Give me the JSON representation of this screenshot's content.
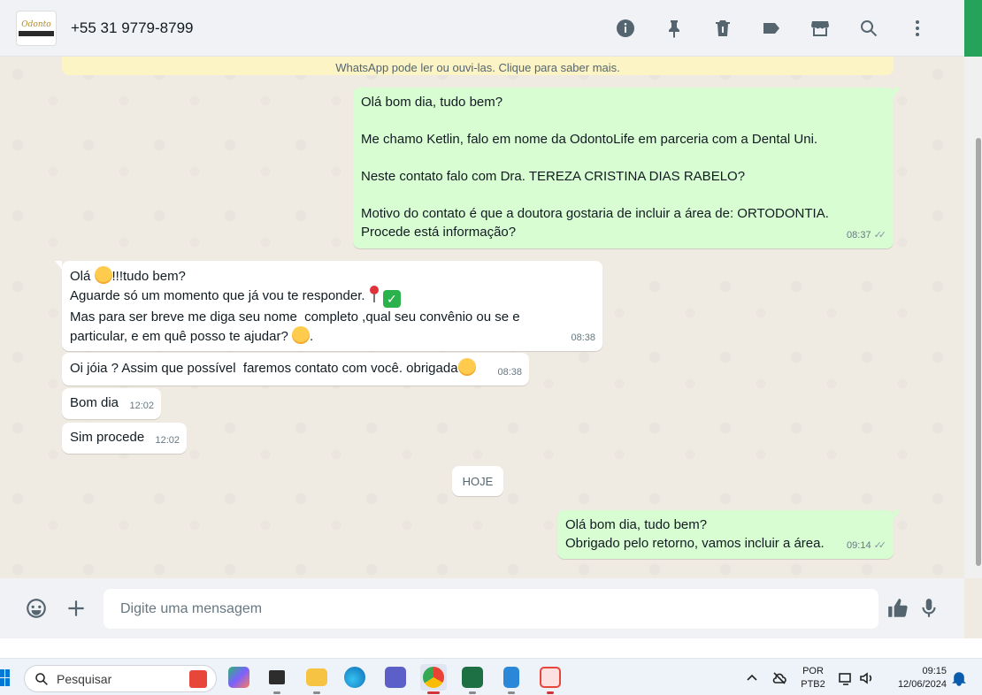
{
  "header": {
    "contact_name": "+55 31 9779-8799",
    "icons": [
      "info-icon",
      "pin-icon",
      "delete-icon",
      "label-icon",
      "store-icon",
      "search-icon",
      "menu-icon"
    ]
  },
  "encryption_notice": "WhatsApp pode ler ou ouvi-las. Clique para saber mais.",
  "messages": [
    {
      "direction": "out",
      "lines": [
        "Olá bom dia, tudo bem?",
        "",
        "Me chamo Ketlin, falo em nome da OdontoLife em parceria com a Dental Uni.",
        "",
        "Neste contato falo com Dra. TEREZA CRISTINA DIAS RABELO?",
        "",
        "Motivo do contato é que a doutora gostaria de incluir a área de: ORTODONTIA.",
        "Procede está informação?"
      ],
      "time": "08:37",
      "ticks": "✓✓"
    },
    {
      "direction": "in",
      "line1_a": "Olá ",
      "line1_b": "!!!tudo bem?",
      "line2": "Aguarde só um momento que já vou te responder. ",
      "line3": "Mas para ser breve me diga seu nome  completo ,qual seu convênio ou se e",
      "line4_a": "particular, e em quê posso te ajudar? ",
      "line4_b": ".",
      "time": "08:38"
    },
    {
      "direction": "in",
      "text": "Oi jóia ? Assim que possível  faremos contato com você. obrigada",
      "time": "08:38"
    },
    {
      "direction": "in",
      "text": "Bom dia",
      "time": "12:02"
    },
    {
      "direction": "in",
      "text": "Sim procede",
      "time": "12:02"
    },
    {
      "direction": "out",
      "lines": [
        "Olá bom dia, tudo bem?",
        "Obrigado pelo retorno, vamos incluir a área."
      ],
      "time": "09:14",
      "ticks": "✓✓"
    }
  ],
  "date_chip": "HOJE",
  "composer": {
    "placeholder": "Digite uma mensagem"
  },
  "taskbar": {
    "search_label": "Pesquisar",
    "language_line1": "POR",
    "language_line2": "PTB2",
    "time": "09:15",
    "date": "12/06/2024"
  },
  "colors": {
    "outgoing_bubble": "#d9fdd3",
    "incoming_bubble": "#ffffff",
    "chat_background": "#efeae2",
    "header_background": "#f0f2f5",
    "notice_background": "#fdf4c5"
  }
}
